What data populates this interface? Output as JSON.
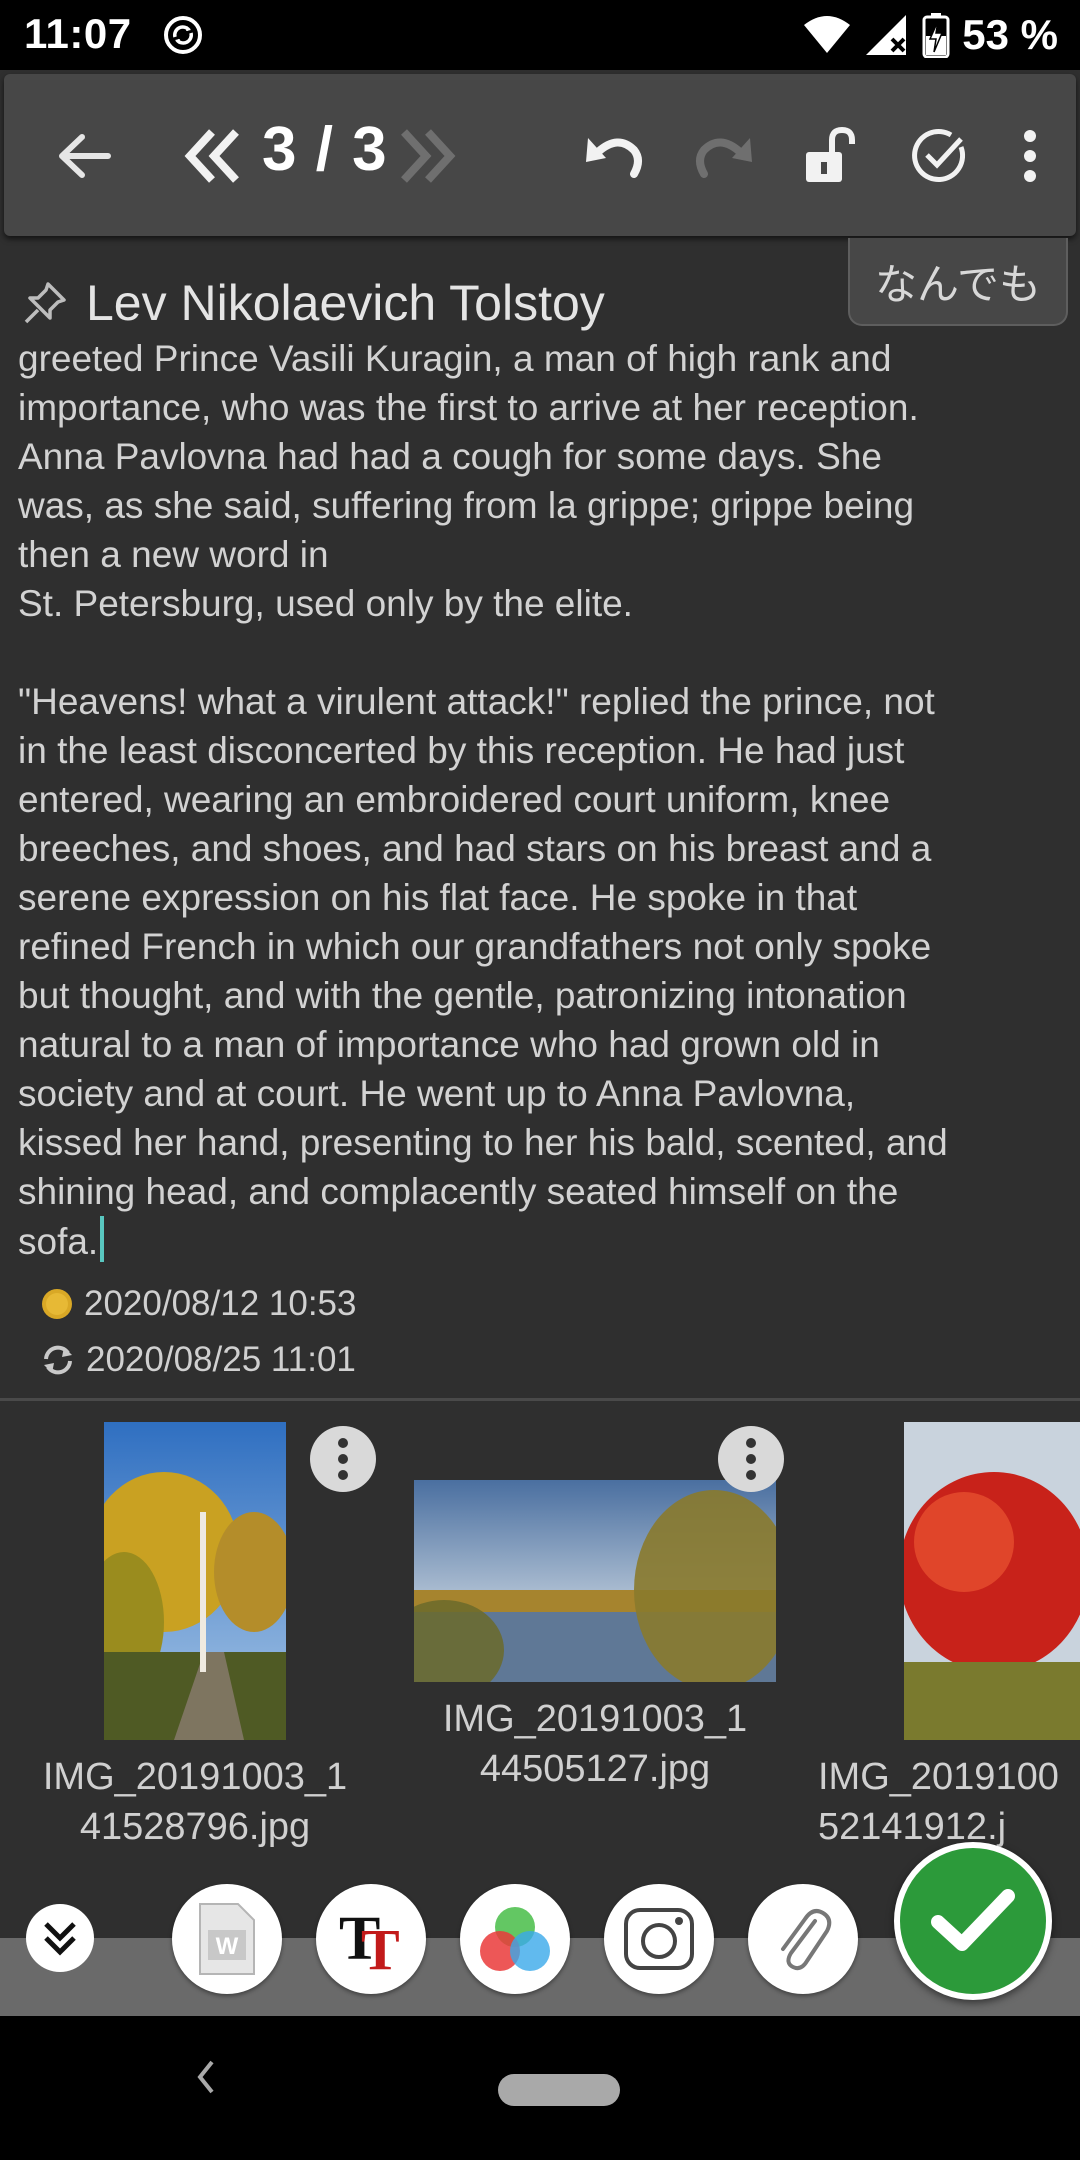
{
  "status_bar": {
    "time": "11:07",
    "battery_percent": "53 %",
    "icons": [
      "sync-circle-icon",
      "wifi-icon",
      "signal-icon",
      "battery-charging-icon"
    ]
  },
  "toolbar": {
    "page_counter": "3 / 3",
    "icons": [
      "back-arrow-icon",
      "previous-page-icon",
      "next-page-icon",
      "undo-icon",
      "redo-icon",
      "unlock-icon",
      "check-circle-icon",
      "overflow-menu-icon"
    ]
  },
  "hint_tab": {
    "label": "なんでも"
  },
  "note": {
    "pin_icon": "pin-icon",
    "title": "Lev Nikolaevich Tolstoy",
    "body": "greeted Prince Vasili Kuragin, a man of high rank and\nimportance, who was the first to arrive at her reception.\nAnna Pavlovna had had a cough for some days. She\nwas, as she said, suffering from la grippe; grippe being\nthen a new word in\nSt. Petersburg, used only by the elite.\n\n\"Heavens! what a virulent attack!\" replied the prince, not\nin the least disconcerted by this reception. He had just\nentered, wearing an embroidered court uniform, knee\nbreeches, and shoes, and had stars on his breast and a\nserene expression on his flat face. He spoke in that\nrefined French in which our grandfathers not only spoke\nbut thought, and with the gentle, patronizing intonation\nnatural to a man of importance who had grown old in\nsociety and at court. He went up to Anna Pavlovna,\nkissed her hand, presenting to her his bald, scented, and\nshining head, and complacently seated himself on the\nsofa.",
    "created": "2020/08/12 10:53",
    "updated": "2020/08/25 11:01"
  },
  "attachments": [
    {
      "filename": "IMG_20191003_1\n41528796.jpg"
    },
    {
      "filename": "IMG_20191003_1\n44505127.jpg"
    },
    {
      "filename": "IMG_2019100\n52141912.j"
    }
  ],
  "bottom_bar": {
    "buttons": [
      "collapse-icon",
      "word-document-icon",
      "text-format-icon",
      "color-circles-icon",
      "camera-icon",
      "paperclip-icon",
      "confirm-check-icon"
    ]
  },
  "colors": {
    "background": "#2f2f2f",
    "toolbar": "#474747",
    "confirm_green": "#2c9a3a",
    "caret": "#59c7c0"
  }
}
